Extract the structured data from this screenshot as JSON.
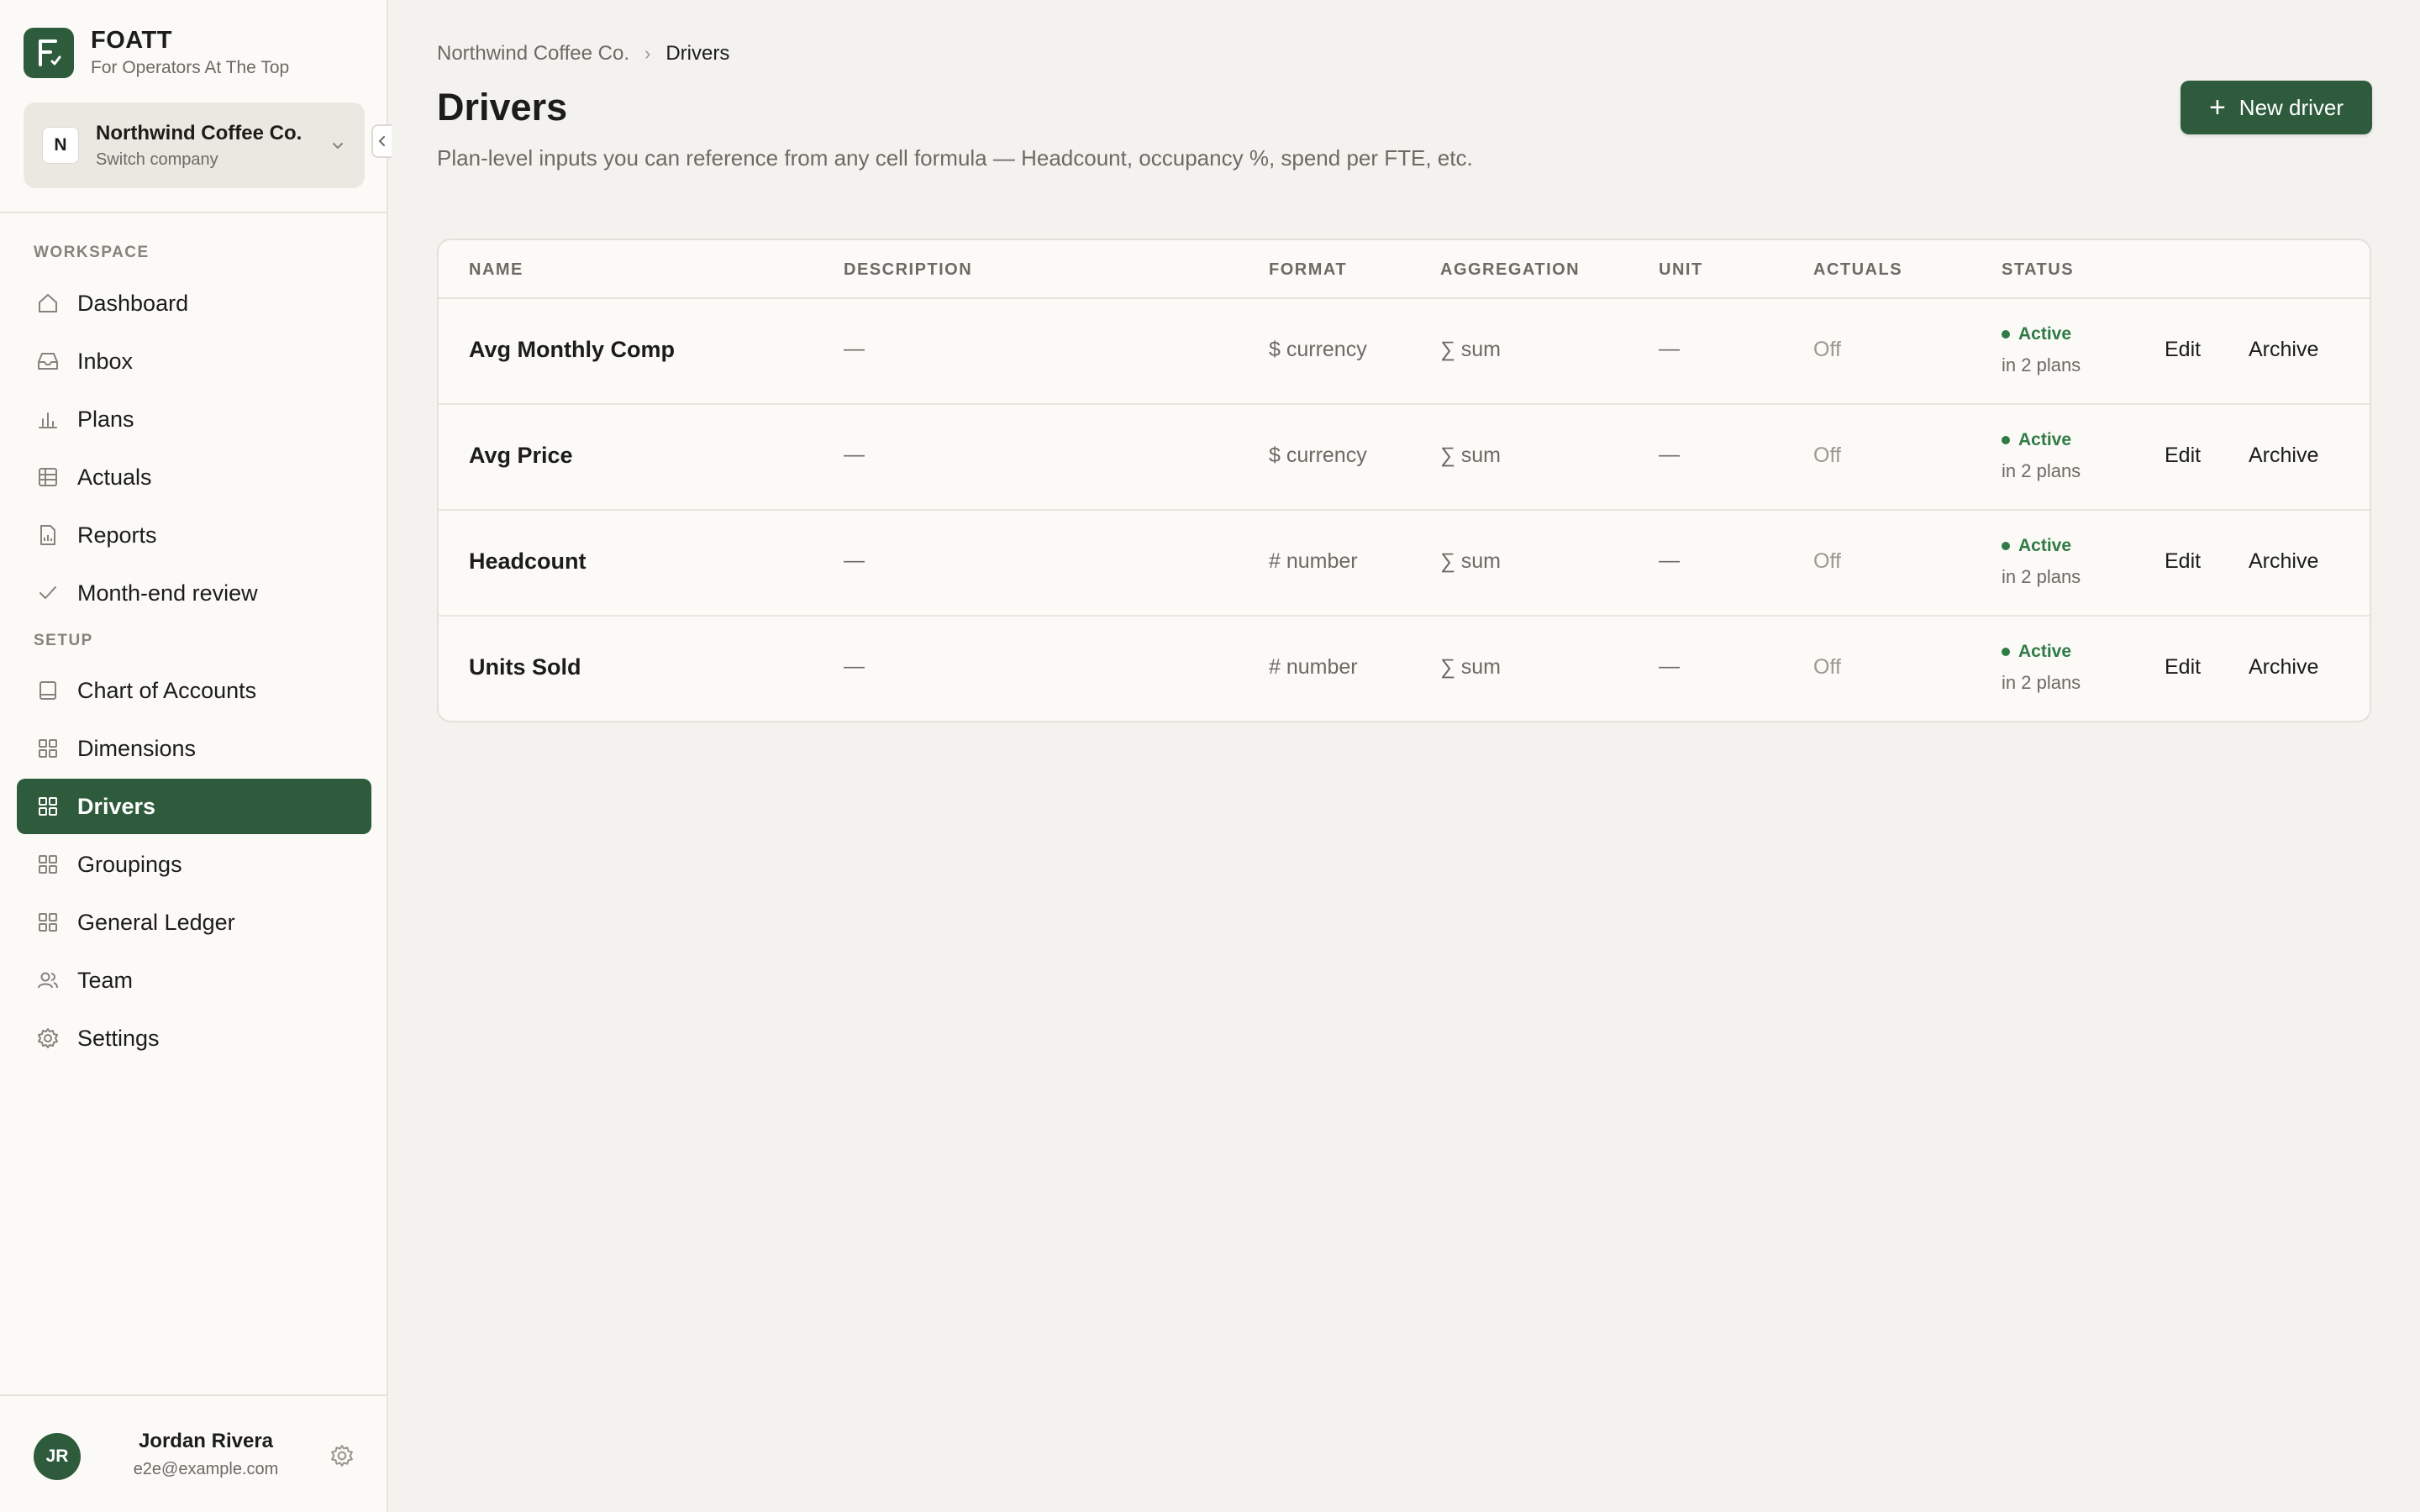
{
  "brand": {
    "name": "FOATT",
    "tagline": "For Operators At The Top",
    "logo_letter": "F"
  },
  "company": {
    "initial": "N",
    "name": "Northwind Coffee Co.",
    "switch_label": "Switch company"
  },
  "sidebar": {
    "workspace_label": "WORKSPACE",
    "setup_label": "SETUP",
    "workspace_items": [
      {
        "label": "Dashboard",
        "icon": "home-icon"
      },
      {
        "label": "Inbox",
        "icon": "inbox-icon"
      },
      {
        "label": "Plans",
        "icon": "bar-chart-icon"
      },
      {
        "label": "Actuals",
        "icon": "table-icon"
      },
      {
        "label": "Reports",
        "icon": "report-icon"
      },
      {
        "label": "Month-end review",
        "icon": "check-icon"
      }
    ],
    "setup_items": [
      {
        "label": "Chart of Accounts",
        "icon": "book-icon"
      },
      {
        "label": "Dimensions",
        "icon": "grid-icon"
      },
      {
        "label": "Drivers",
        "icon": "grid-icon",
        "active": true
      },
      {
        "label": "Groupings",
        "icon": "grid-icon"
      },
      {
        "label": "General Ledger",
        "icon": "grid-icon"
      },
      {
        "label": "Team",
        "icon": "users-icon"
      },
      {
        "label": "Settings",
        "icon": "gear-icon"
      }
    ]
  },
  "user": {
    "initials": "JR",
    "name": "Jordan Rivera",
    "email": "e2e@example.com"
  },
  "breadcrumb": {
    "parent": "Northwind Coffee Co.",
    "separator": "›",
    "current": "Drivers"
  },
  "page": {
    "title": "Drivers",
    "description": "Plan-level inputs you can reference from any cell formula — Headcount, occupancy %, spend per FTE, etc.",
    "new_button": "New driver",
    "new_button_icon": "+"
  },
  "table": {
    "headers": {
      "name": "NAME",
      "description": "DESCRIPTION",
      "format": "FORMAT",
      "aggregation": "AGGREGATION",
      "unit": "UNIT",
      "actuals": "ACTUALS",
      "status": "STATUS"
    },
    "rows": [
      {
        "name": "Avg Monthly Comp",
        "description": "—",
        "format": "$ currency",
        "aggregation": "∑ sum",
        "unit": "—",
        "actuals": "Off",
        "status": "Active",
        "status_sub": "in 2 plans",
        "edit": "Edit",
        "archive": "Archive"
      },
      {
        "name": "Avg Price",
        "description": "—",
        "format": "$ currency",
        "aggregation": "∑ sum",
        "unit": "—",
        "actuals": "Off",
        "status": "Active",
        "status_sub": "in 2 plans",
        "edit": "Edit",
        "archive": "Archive"
      },
      {
        "name": "Headcount",
        "description": "—",
        "format": "# number",
        "aggregation": "∑ sum",
        "unit": "—",
        "actuals": "Off",
        "status": "Active",
        "status_sub": "in 2 plans",
        "edit": "Edit",
        "archive": "Archive"
      },
      {
        "name": "Units Sold",
        "description": "—",
        "format": "# number",
        "aggregation": "∑ sum",
        "unit": "—",
        "actuals": "Off",
        "status": "Active",
        "status_sub": "in 2 plans",
        "edit": "Edit",
        "archive": "Archive"
      }
    ]
  },
  "colors": {
    "accent": "#2f5b3d",
    "status_active": "#2f7a45",
    "background": "#f3f2ee",
    "sidebar_bg": "#fbfaf7"
  }
}
